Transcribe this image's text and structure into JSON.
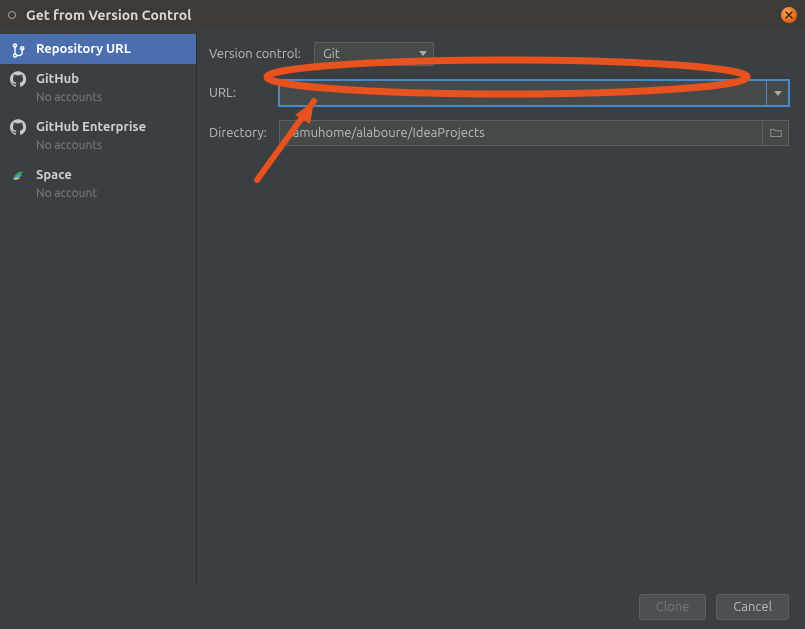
{
  "titlebar": {
    "title": "Get from Version Control"
  },
  "sidebar": {
    "items": [
      {
        "name": "Repository URL",
        "sub": ""
      },
      {
        "name": "GitHub",
        "sub": "No accounts"
      },
      {
        "name": "GitHub Enterprise",
        "sub": "No accounts"
      },
      {
        "name": "Space",
        "sub": "No account"
      }
    ]
  },
  "form": {
    "vc_label": "Version control:",
    "vc_value": "Git",
    "url_label": "URL:",
    "url_value": "",
    "dir_label": "Directory:",
    "dir_value": "/amuhome/alaboure/IdeaProjects"
  },
  "buttons": {
    "clone": "Clone",
    "cancel": "Cancel"
  }
}
